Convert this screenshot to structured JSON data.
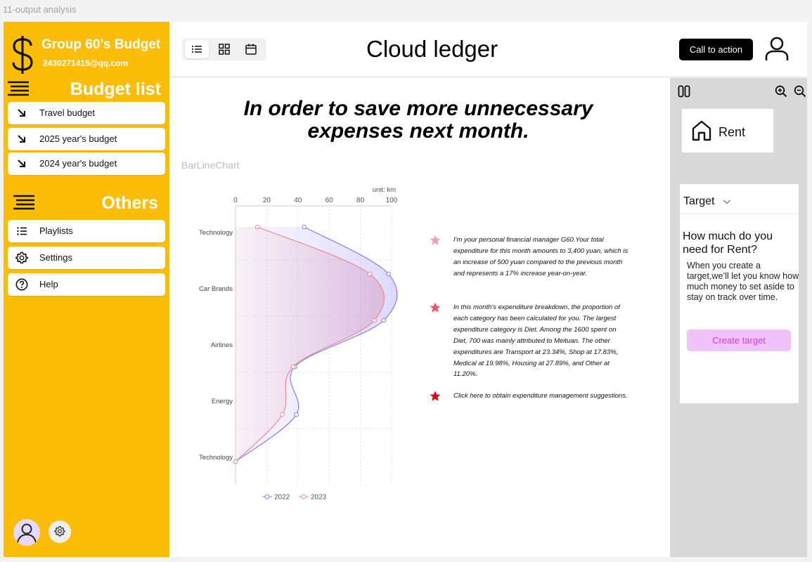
{
  "frame": {
    "title": "11-output analysis"
  },
  "sidebar": {
    "brand_name": "Group 60’s Budget",
    "brand_email": "2430271415@qq.com",
    "budget_list_title": "Budget list",
    "budget_items": [
      {
        "label": "Travel budget",
        "icon": "arrow-down-right-icon"
      },
      {
        "label": "2025 year's budget",
        "icon": "arrow-down-right-icon"
      },
      {
        "label": "2024 year's budget",
        "icon": "arrow-down-right-icon"
      }
    ],
    "others_title": "Others",
    "other_items": [
      {
        "label": "Playlists",
        "icon": "list-icon"
      },
      {
        "label": "Settings",
        "icon": "gear-icon"
      },
      {
        "label": "Help",
        "icon": "help-circle-icon"
      }
    ],
    "accent_color": "#fbbd06"
  },
  "header": {
    "title": "Cloud ledger",
    "cta_label": "Call to action",
    "view_modes": [
      "list-icon",
      "grid-icon",
      "calendar-icon"
    ],
    "active_view": "list-icon"
  },
  "main": {
    "headline": "In order to save more unnecessary expenses next month.",
    "chart_caption": "BarLineChart",
    "insights": [
      {
        "star_color": "#f7a1a8",
        "text": "I'm your personal financial manager G60.Your total expenditure for this month amounts to 3,400 yuan, which is an increase of 500 yuan compared to the previous month and represents a 17% increase year-on-year."
      },
      {
        "star_color": "#f0555d",
        "text": "In this month's expenditure breakdown, the proportion of each category has been calculated for you. The largest expenditure category is Diet. Among the 1600 spent on Diet, 700 was mainly attributed to Meituan. The other expenditures are Transport at 23.34%, Shop at 17.83%, Medical at 19.98%, Housing at 27.89%, and Other at 11.20%."
      },
      {
        "star_color": "#d80d0d",
        "text": "Click here to obtain expenditure management suggestions."
      }
    ]
  },
  "chart_data": {
    "type": "area",
    "orientation": "horizontal",
    "unit_label": "unit: km",
    "categories": [
      "Technology",
      "Car Brands",
      "Airlines",
      "Energy",
      "Technology"
    ],
    "x_ticks": [
      0,
      20,
      40,
      60,
      80,
      100
    ],
    "xlim": [
      0,
      100
    ],
    "series": [
      {
        "name": "2022",
        "color": "#8a7cff",
        "values": [
          44,
          98,
          95,
          38,
          39,
          0
        ]
      },
      {
        "name": "2023",
        "color": "#f08a8f",
        "values": [
          14,
          86,
          89,
          37,
          30,
          0
        ]
      }
    ],
    "grid": true,
    "legend_position": "bottom"
  },
  "right_panel": {
    "rent_label": "Rent",
    "target_label": "Target",
    "target_question": "How much do you need for Rent?",
    "target_description": "When you create a target,we’ll let you know how much money to set aside to stay on track over time.",
    "create_button": "Create target"
  }
}
